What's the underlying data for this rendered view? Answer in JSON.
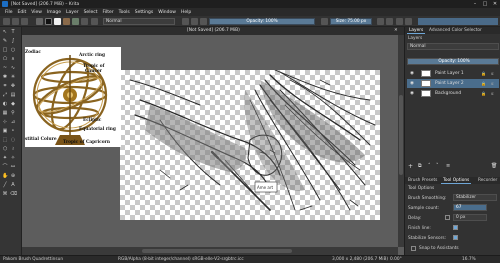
{
  "window": {
    "title": "[Not Saved] (206.7 MiB) – Krita",
    "minimize": "–",
    "maximize": "□",
    "close": "✕"
  },
  "menu": [
    "File",
    "Edit",
    "View",
    "Image",
    "Layer",
    "Select",
    "Filter",
    "Tools",
    "Settings",
    "Window",
    "Help"
  ],
  "toolbar": {
    "blend_mode": "Normal",
    "opacity": "Opacity: 100%",
    "size": "Size: 75.00 px"
  },
  "document": {
    "tab_title": "[Not Saved] (206.7 MiB)",
    "tab_close": "✕"
  },
  "reference": {
    "labels": {
      "zodiac": "Zodiac",
      "arctic": "Arctic ring",
      "cancer": "Tropic of",
      "cancer2": "Cancer",
      "ecliptic": "Ecliptic",
      "equatorial": "Equatorial ring",
      "colure": "stitial Colure",
      "capricorn": "Tropic of Capricorn"
    }
  },
  "sketch": {
    "signature": "Ame art"
  },
  "dock": {
    "tabs_top": [
      "Layers",
      "Advanced Color Selector"
    ],
    "layers_title": "Layers",
    "blend_mode": "Normal",
    "opacity": "Opacity: 100%",
    "layers": [
      {
        "name": "Paint Layer 1",
        "selected": false
      },
      {
        "name": "Paint Layer 2",
        "selected": true
      },
      {
        "name": "Background",
        "selected": false
      }
    ],
    "tabs_bottom": [
      "Brush Presets",
      "Tool Options",
      "Recorder"
    ],
    "tool_options_title": "Tool Options",
    "brush_smoothing_label": "Brush Smoothing:",
    "brush_smoothing_value": "Stabilizer",
    "sample_count_label": "Sample count:",
    "sample_count_value": "67",
    "delay_label": "Delay:",
    "delay_value": "0 px",
    "finish_line_label": "Finish line:",
    "stabilize_sensors_label": "Stabilize Sensors:",
    "snap_label": "Snap to Assistants"
  },
  "status": {
    "brush": "Pakom Brush Quadrettinsun",
    "color": "RGB/Alpha (8-bit integer/channel)  sRGB-elle-V2-srgbtrc.icc",
    "size": "3,000 x 2,480 (206.7 MiB)",
    "rotation": "0.00°",
    "zoom": "16.7%"
  },
  "colors": {
    "accent": "#6fa7d8",
    "selected_layer": "#4a6d8c",
    "opacity_bar": "#5a7a96"
  }
}
